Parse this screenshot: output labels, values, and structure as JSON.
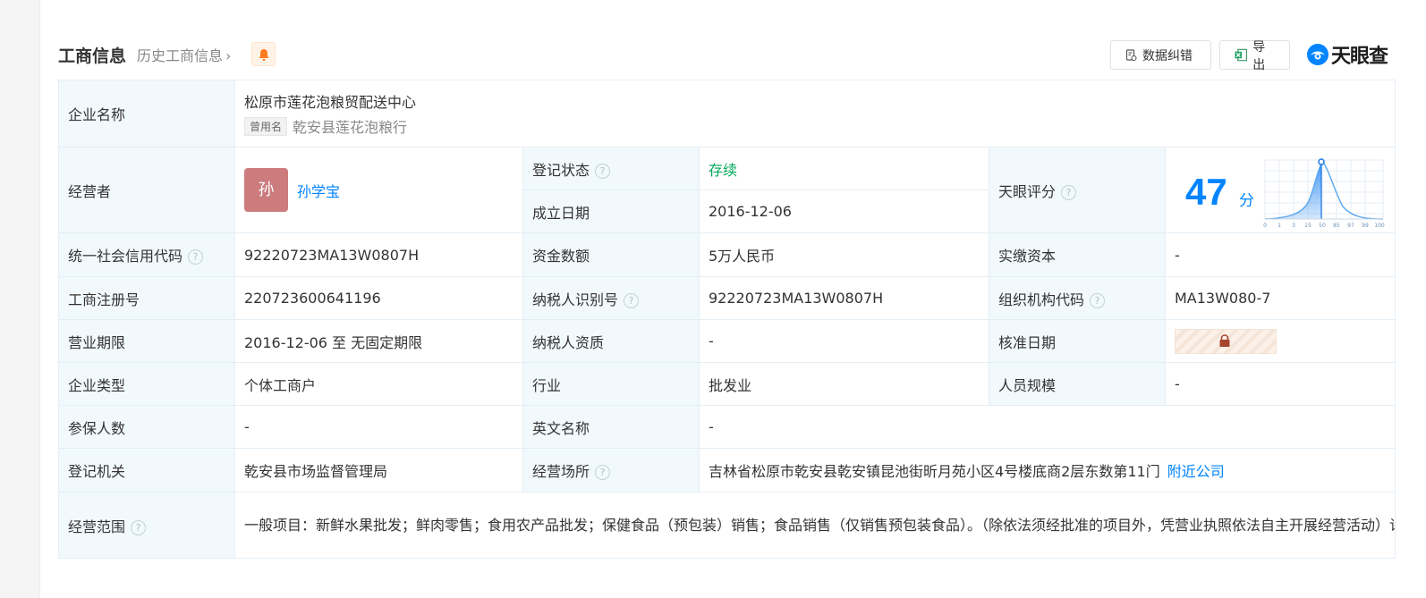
{
  "header": {
    "title": "工商信息",
    "history_label": "历史工商信息",
    "correct_button": "数据纠错",
    "export_button": "导出",
    "logo_text": "天眼查",
    "colors": {
      "accent": "#0084ff",
      "label_bg": "#f2f9fd",
      "bell": "#ff7a1f",
      "status": "#00a859"
    }
  },
  "company": {
    "name_label": "企业名称",
    "name": "松原市莲花泡粮贸配送中心",
    "alias_tag": "曾用名",
    "alias": "乾安县莲花泡粮行"
  },
  "operator": {
    "label": "经营者",
    "avatar_char": "孙",
    "name": "孙学宝"
  },
  "fields": {
    "reg_status_label": "登记状态",
    "reg_status": "存续",
    "found_date_label": "成立日期",
    "found_date": "2016-12-06",
    "score_label": "天眼评分",
    "score": "47",
    "score_unit": "分",
    "score_axis": [
      "0",
      "1",
      "3",
      "15",
      "50",
      "85",
      "97",
      "99",
      "100"
    ],
    "credit_code_label": "统一社会信用代码",
    "credit_code": "92220723MA13W0807H",
    "capital_label": "资金数额",
    "capital": "5万人民币",
    "paid_capital_label": "实缴资本",
    "paid_capital": "-",
    "reg_no_label": "工商注册号",
    "reg_no": "220723600641196",
    "taxpayer_id_label": "纳税人识别号",
    "taxpayer_id": "92220723MA13W0807H",
    "org_code_label": "组织机构代码",
    "org_code": "MA13W080-7",
    "term_label": "营业期限",
    "term": "2016-12-06 至 无固定期限",
    "taxpayer_qual_label": "纳税人资质",
    "taxpayer_qual": "-",
    "approve_date_label": "核准日期",
    "type_label": "企业类型",
    "type": "个体工商户",
    "industry_label": "行业",
    "industry": "批发业",
    "staff_label": "人员规模",
    "staff": "-",
    "insured_label": "参保人数",
    "insured": "-",
    "english_name_label": "英文名称",
    "english_name": "-",
    "authority_label": "登记机关",
    "authority": "乾安县市场监督管理局",
    "address_label": "经营场所",
    "address": "吉林省松原市乾安县乾安镇昆池街昕月苑小区4号楼底商2层东数第11门",
    "nearby_link": "附近公司",
    "scope_label": "经营范围",
    "scope": "一般项目：新鲜水果批发；鲜肉零售；食用农产品批发；保健食品（预包装）销售；食品销售（仅销售预包装食品）。（除依法须经批准的项目外，凭营业执照依法自主开展经营活动）许可项目：食品销售。（依法须经批准的项目，经相关部门批准后方可开展经营活动，具体经营项目以相关部门批准文件或许可证件为准）"
  }
}
